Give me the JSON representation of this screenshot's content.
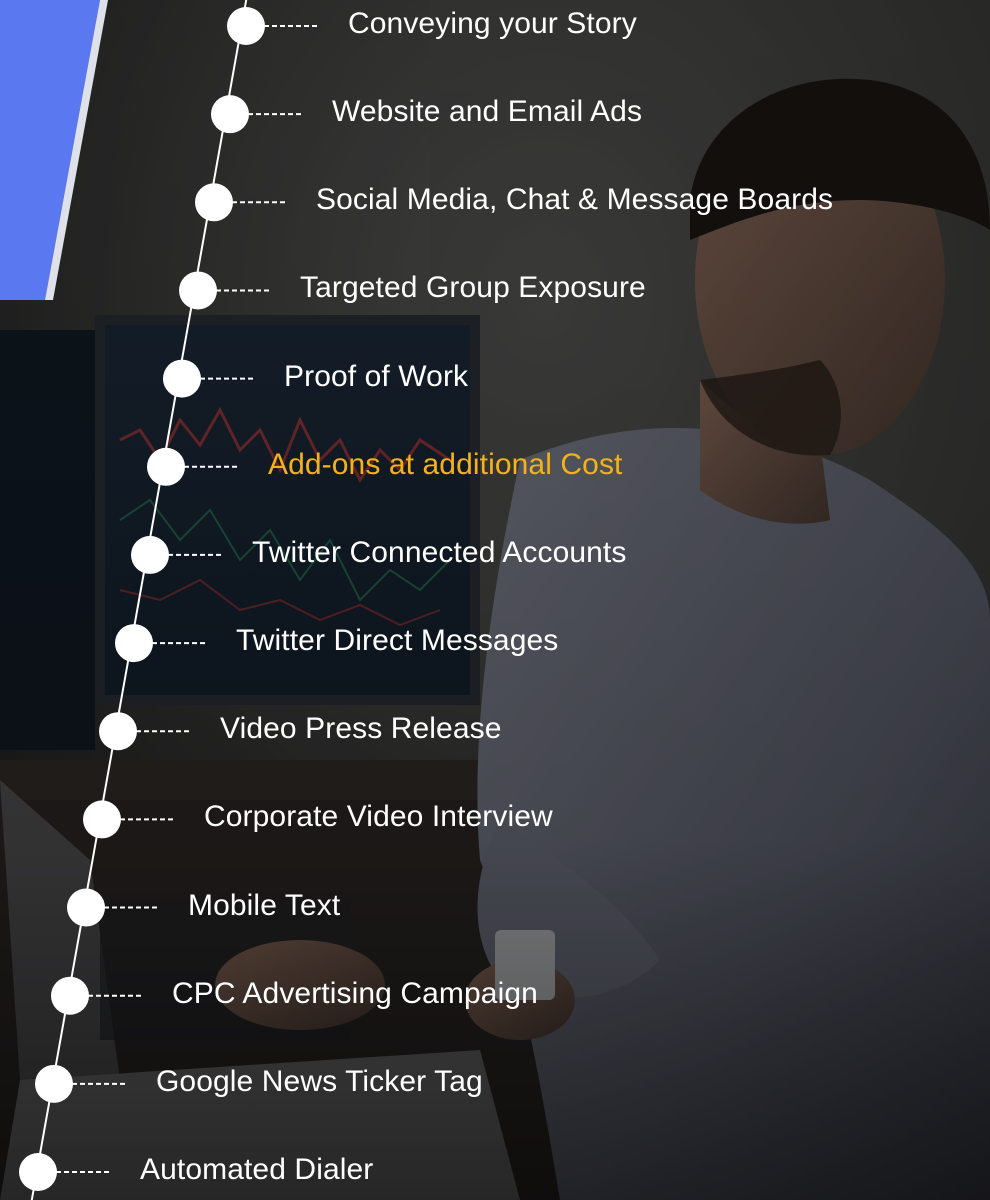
{
  "colors": {
    "accent_blue": "#5a78f0",
    "highlight": "#f3b21b",
    "text": "#ffffff"
  },
  "timeline": {
    "items": [
      {
        "label": "Conveying your Story",
        "highlight": false
      },
      {
        "label": "Website and Email Ads",
        "highlight": false
      },
      {
        "label": "Social Media, Chat & Message Boards",
        "highlight": false
      },
      {
        "label": "Targeted Group Exposure",
        "highlight": false
      },
      {
        "label": "Proof of Work",
        "highlight": false
      },
      {
        "label": "Add-ons at additional Cost",
        "highlight": true
      },
      {
        "label": "Twitter Connected Accounts",
        "highlight": false
      },
      {
        "label": "Twitter Direct Messages",
        "highlight": false
      },
      {
        "label": "Video Press Release",
        "highlight": false
      },
      {
        "label": "Corporate Video Interview",
        "highlight": false
      },
      {
        "label": "Mobile Text",
        "highlight": false
      },
      {
        "label": "CPC Advertising Campaign",
        "highlight": false
      },
      {
        "label": "Google News Ticker Tag",
        "highlight": false
      },
      {
        "label": "Automated Dialer",
        "highlight": false
      }
    ]
  }
}
